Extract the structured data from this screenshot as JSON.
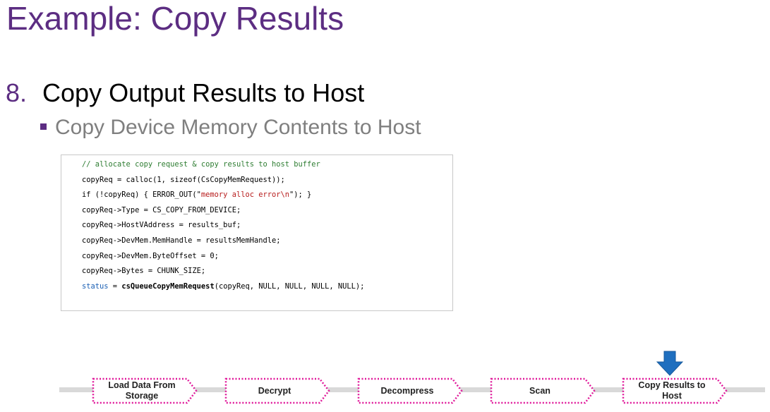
{
  "slide": {
    "title": "Example: Copy Results"
  },
  "step": {
    "number": "8.",
    "title": "Copy Output Results to Host",
    "sub_bullet": "Copy Device Memory Contents to Host"
  },
  "code": {
    "comment": "// allocate copy request & copy results to host buffer",
    "line2": "copyReq = calloc(1, sizeof(CsCopyMemRequest));",
    "line3_pre": "if (!copyReq) { ERROR_OUT(\"",
    "line3_str": "memory alloc error\\n",
    "line3_post": "\"); }",
    "line4": "copyReq->Type = CS_COPY_FROM_DEVICE;",
    "line5": "copyReq->HostVAddress = results_buf;",
    "line6": "copyReq->DevMem.MemHandle = resultsMemHandle;",
    "line7": "copyReq->DevMem.ByteOffset = 0;",
    "line8": "copyReq->Bytes = CHUNK_SIZE;",
    "line9_kw": "status",
    "line9_eq": " = ",
    "line9_fn": "csQueueCopyMemRequest",
    "line9_args": "(copyReq, NULL, NULL, NULL, NULL);"
  },
  "pipeline": {
    "stages": [
      {
        "line1": "Load Data From",
        "line2": "Storage"
      },
      {
        "line1": "Decrypt",
        "line2": ""
      },
      {
        "line1": "Decompress",
        "line2": ""
      },
      {
        "line1": "Scan",
        "line2": ""
      },
      {
        "line1": "Copy Results to",
        "line2": "Host"
      }
    ],
    "active_stage": "Copy Results to Host",
    "pointer_icon": "arrow-down-icon"
  },
  "colors": {
    "title": "#5c2d82",
    "stage_border": "#e0189a",
    "pipeline_line": "#d9d9d9",
    "pointer_arrow": "#1f6fbf",
    "code_comment": "#2e7d32",
    "code_string": "#b71c1c",
    "code_keyword": "#1a5fb4"
  }
}
